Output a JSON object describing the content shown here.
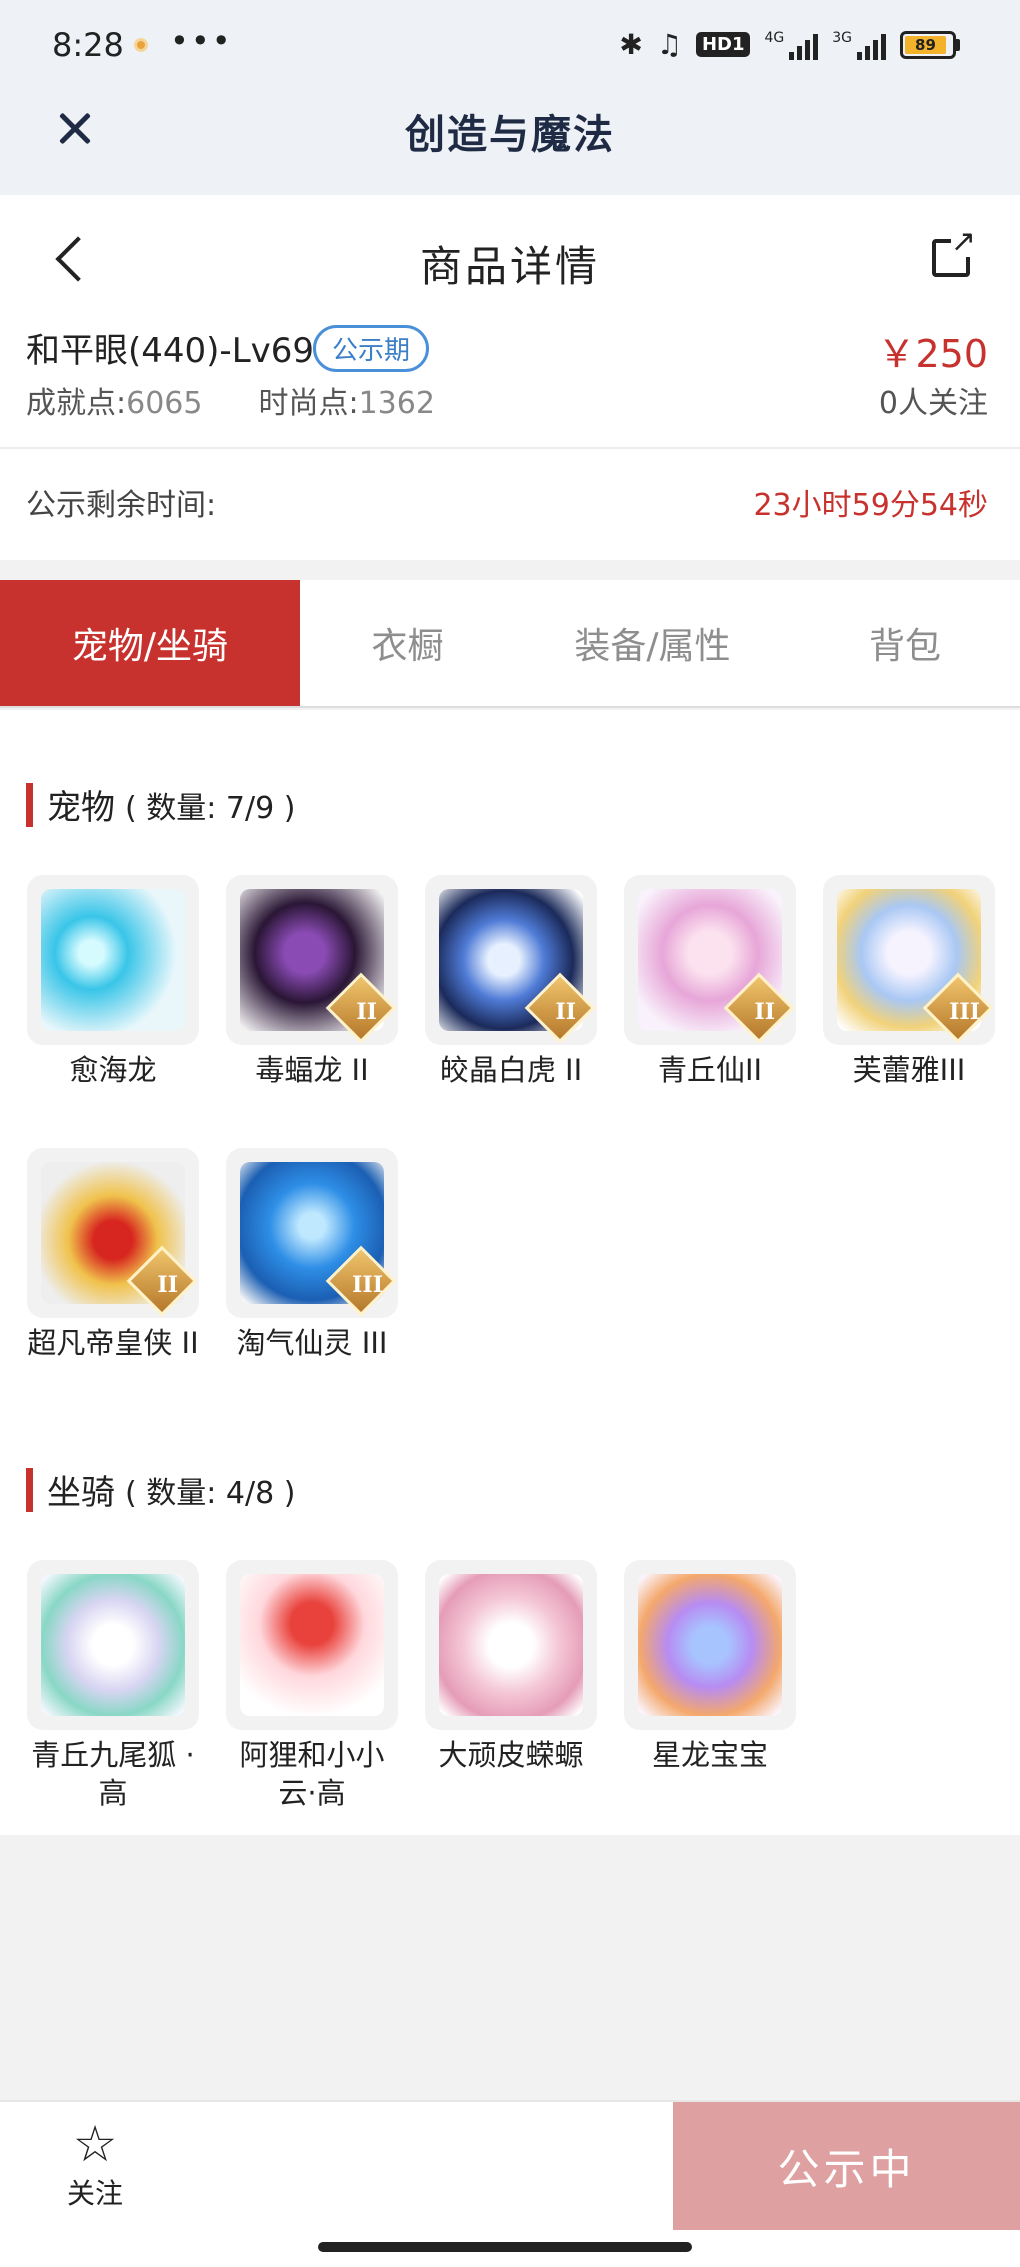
{
  "status_bar": {
    "time": "8:28",
    "more": "•••",
    "bluetooth_icon": "bluetooth-icon",
    "hd_label": "HD1",
    "net1_label": "4G",
    "net2_label": "3G",
    "battery": "89"
  },
  "app_header": {
    "title": "创造与魔法",
    "close_icon": "close-icon"
  },
  "detail": {
    "page_title": "商品详情",
    "role_name": "和平眼(440)-Lv69",
    "status_chip": "公示期",
    "price": "￥250",
    "achievement_label": "成就点:",
    "achievement_value": "6065",
    "fashion_label": "时尚点:",
    "fashion_value": "1362",
    "followers": "0人关注",
    "remain_label": "公示剩余时间:",
    "remain_time": "23小时59分54秒"
  },
  "tabs": [
    {
      "label": "宠物/坐骑",
      "active": true
    },
    {
      "label": "衣橱",
      "active": false
    },
    {
      "label": "装备/属性",
      "active": false
    },
    {
      "label": "背包",
      "active": false
    }
  ],
  "pets": {
    "title": "宠物",
    "count": "( 数量:  7/9 )",
    "items": [
      {
        "name": "愈海龙",
        "rank": ""
      },
      {
        "name": "毒蝠龙 II",
        "rank": "II"
      },
      {
        "name": "皎晶白虎 II",
        "rank": "II"
      },
      {
        "name": "青丘仙II",
        "rank": "II"
      },
      {
        "name": "芙蕾雅III",
        "rank": "III"
      },
      {
        "name": "超凡帝皇侠 II",
        "rank": "II"
      },
      {
        "name": "淘气仙灵 III",
        "rank": "III"
      }
    ]
  },
  "mounts": {
    "title": "坐骑",
    "count": "( 数量:  4/8 )",
    "items": [
      {
        "name": "青丘九尾狐 ·高"
      },
      {
        "name": "阿狸和小小云·高"
      },
      {
        "name": "大顽皮蝾螈"
      },
      {
        "name": "星龙宝宝"
      }
    ]
  },
  "bottom_bar": {
    "follow_label": "关注",
    "status_button": "公示中"
  }
}
